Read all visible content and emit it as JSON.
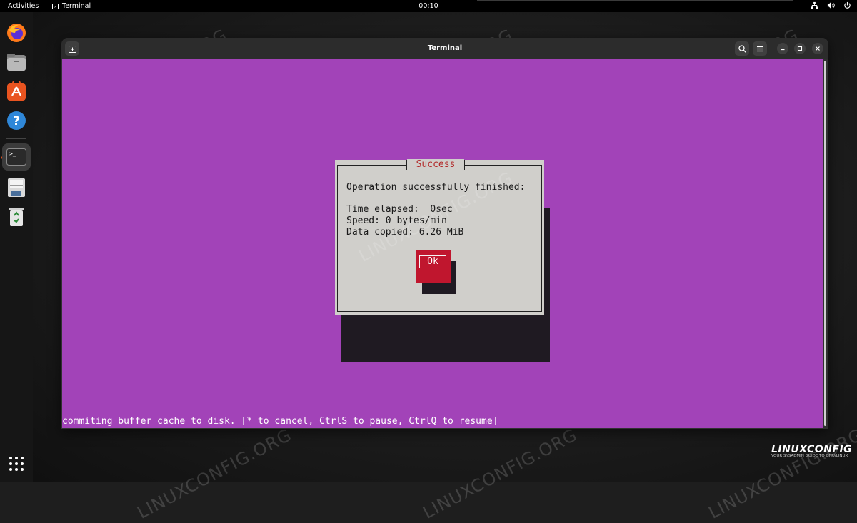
{
  "topbar": {
    "activities": "Activities",
    "app_name": "Terminal",
    "clock": "00:10",
    "status_icons": [
      "network-icon",
      "volume-icon",
      "power-icon"
    ]
  },
  "dock": {
    "items": [
      {
        "name": "firefox",
        "icon": "firefox-icon"
      },
      {
        "name": "files",
        "icon": "files-icon"
      },
      {
        "name": "software",
        "icon": "app-store-icon"
      },
      {
        "name": "help",
        "icon": "help-icon"
      },
      {
        "name": "terminal",
        "icon": "terminal-icon",
        "active": true
      },
      {
        "name": "save",
        "icon": "floppy-icon"
      },
      {
        "name": "trash",
        "icon": "trash-icon"
      }
    ],
    "show_apps_icon": "apps-grid-icon"
  },
  "window": {
    "title": "Terminal",
    "colors": {
      "terminal_bg": "#a243b8",
      "dialog_bg": "#d0cfcb",
      "accent_red": "#c0162e",
      "title_red": "#b22a2a"
    }
  },
  "dialog": {
    "title": "Success",
    "lines": [
      "Operation successfully finished:",
      "",
      "Time elapsed:  0sec",
      "Speed: 0 bytes/min",
      "Data copied: 6.26 MiB"
    ],
    "ok_label": "Ok"
  },
  "terminal": {
    "status_line": "commiting buffer cache to disk. [* to cancel, CtrlS to pause, CtrlQ to resume]"
  },
  "watermark": "LINUXCONFIG.ORG",
  "logo": {
    "name": "LINUXCONFIG",
    "tagline": "YOUR SYSADMIN GUIDE TO GNU/LINUX"
  }
}
